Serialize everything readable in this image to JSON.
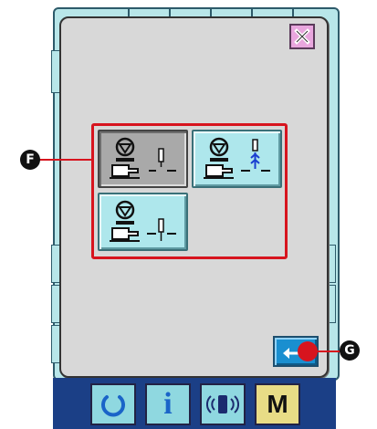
{
  "dialog": {
    "close_icon": "close-x-icon"
  },
  "options": [
    {
      "id": "opt1",
      "icon": "needle-stop-up-icon",
      "selected": true
    },
    {
      "id": "opt2",
      "icon": "needle-thread-pull-icon",
      "selected": false
    },
    {
      "id": "opt3",
      "icon": "needle-stop-down-icon",
      "selected": false
    }
  ],
  "enter_button": {
    "icon": "enter-arrow-icon"
  },
  "callouts": {
    "f_label": "F",
    "g_label": "G"
  },
  "bottom_bar": {
    "info_label": "i",
    "m_label": "M"
  },
  "colors": {
    "accent_red": "#d7141e",
    "option_cyan": "#aee7ec",
    "selected_gray": "#a9a9a9",
    "close_pink": "#e9a6de",
    "enter_blue": "#1a8fd0",
    "bar_navy": "#1b3f86"
  }
}
